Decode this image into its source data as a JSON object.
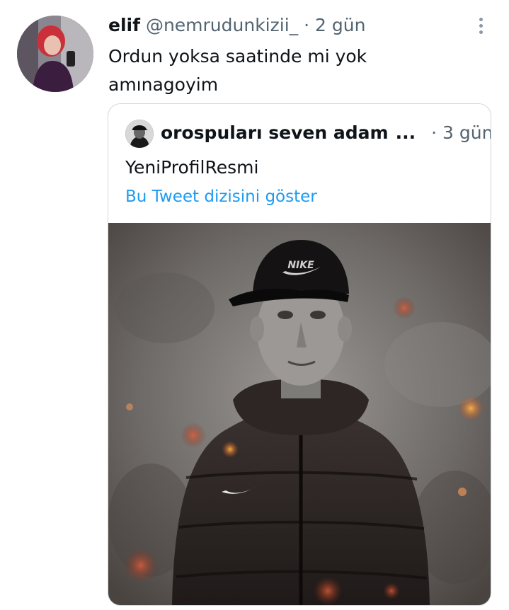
{
  "tweet": {
    "author_name": "elif",
    "author_handle": "@nemrudunkizii_",
    "separator": "·",
    "time": "2 gün",
    "text": "Ordun yoksa saatinde mi yok\namınagoyim"
  },
  "quoted_tweet": {
    "author_name": "orospuları seven adam",
    "ellipsis": "...",
    "separator": "·",
    "time": "3 gün",
    "text": "YeniProfilResmi",
    "thread_link": "Bu Tweet dizisini göster",
    "cap_text": "NIKE"
  },
  "icons": {
    "more": "more-vertical-icon"
  },
  "colors": {
    "link": "#1d9bf0",
    "secondary_text": "#536471",
    "border": "#cfd9de"
  }
}
